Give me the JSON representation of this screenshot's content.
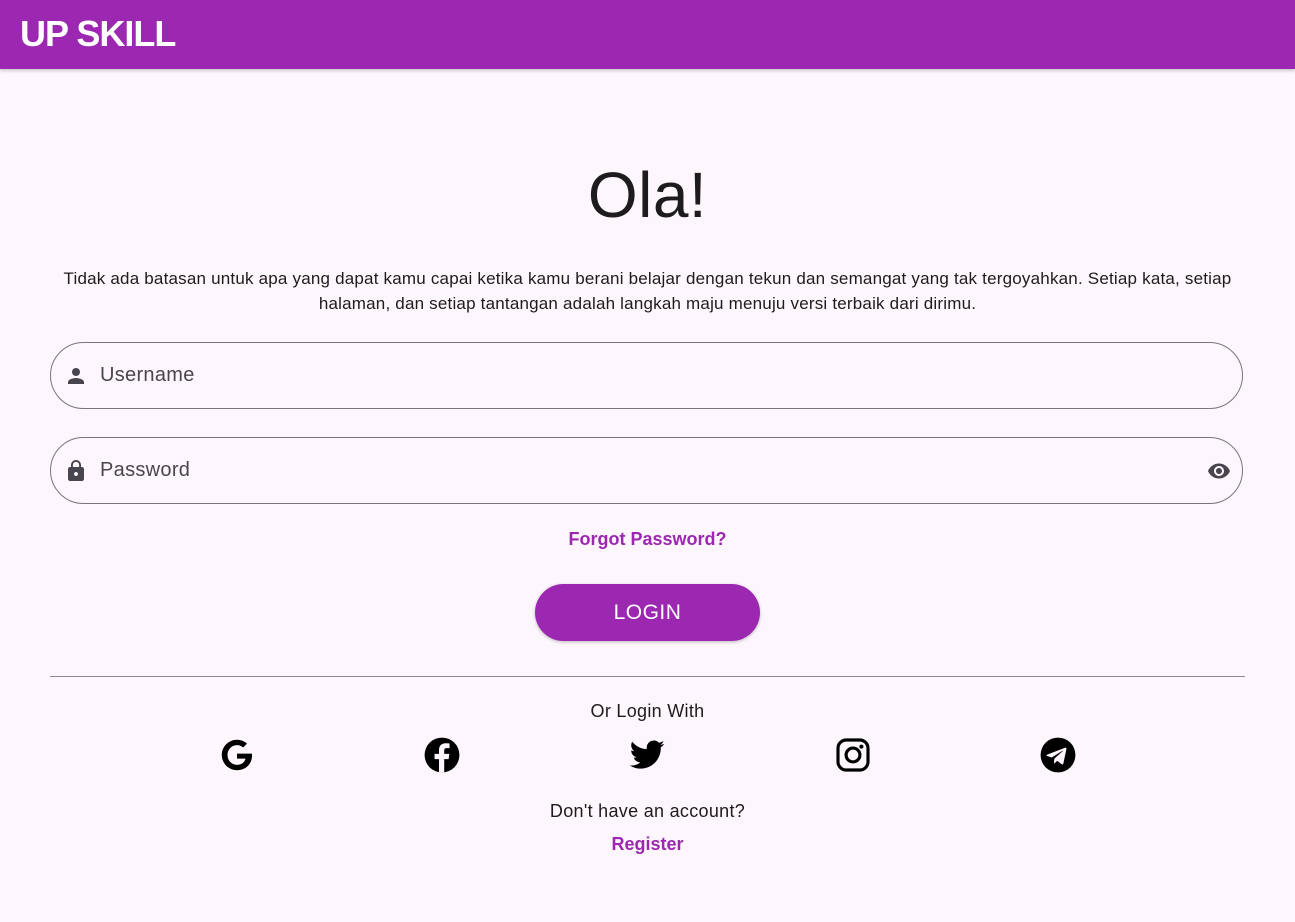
{
  "appbar": {
    "title": "UP SKILL",
    "color": "#9c27b0"
  },
  "main": {
    "heading": "Ola!",
    "intro": "Tidak ada batasan untuk apa yang dapat kamu capai ketika kamu berani belajar dengan tekun dan semangat yang tak tergoyahkan. Setiap kata, setiap halaman, dan setiap tantangan adalah langkah maju menuju versi terbaik dari dirimu."
  },
  "form": {
    "username": {
      "placeholder": "Username",
      "value": "",
      "icon": "person-icon"
    },
    "password": {
      "placeholder": "Password",
      "value": "",
      "icon": "lock-icon",
      "toggle_icon": "eye-icon"
    },
    "forgot_label": "Forgot Password?",
    "login_label": "LOGIN"
  },
  "social": {
    "label": "Or Login With",
    "providers": [
      "google-icon",
      "facebook-icon",
      "twitter-icon",
      "instagram-icon",
      "telegram-icon"
    ]
  },
  "register": {
    "prompt": "Don't have an account?",
    "link_label": "Register"
  }
}
